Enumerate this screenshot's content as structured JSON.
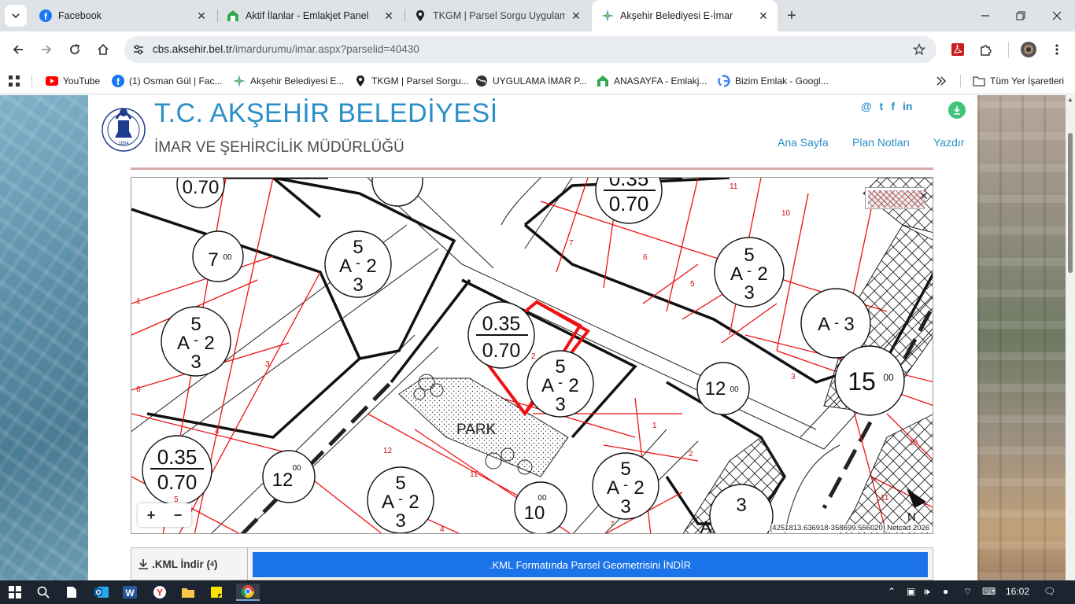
{
  "tabs": [
    {
      "title": "Facebook",
      "icon": "facebook-icon"
    },
    {
      "title": "Aktif İlanlar - Emlakjet Panel",
      "icon": "emlakjet-icon"
    },
    {
      "title": "TKGM | Parsel Sorgu Uygulamas",
      "icon": "map-pin-icon"
    },
    {
      "title": "Akşehir Belediyesi E-İmar",
      "icon": "akşehir-icon",
      "active": true
    }
  ],
  "url": {
    "host": "cbs.aksehir.bel.tr",
    "path": "/imardurumu/imar.aspx?parselid=40430"
  },
  "bookmarks": [
    {
      "label": "YouTube",
      "icon": "youtube-icon"
    },
    {
      "label": "(1) Osman Gül | Fac...",
      "icon": "facebook-icon"
    },
    {
      "label": "Akşehir Belediyesi E...",
      "icon": "akşehir-icon"
    },
    {
      "label": "TKGM | Parsel Sorgu...",
      "icon": "map-pin-icon"
    },
    {
      "label": "UYGULAMA İMAR P...",
      "icon": "globe-icon"
    },
    {
      "label": "ANASAYFA - Emlakj...",
      "icon": "emlakjet-icon"
    },
    {
      "label": "Bizim Emlak - Googl...",
      "icon": "google-icon"
    }
  ],
  "bookmarks_all": "Tüm Yer İşaretleri",
  "header": {
    "title": "T.C. AKŞEHİR BELEDİYESİ",
    "subtitle": "İMAR VE ŞEHİRCİLİK MÜDÜRLÜĞÜ",
    "logo_year": "1854",
    "socials": [
      "@",
      "t",
      "f",
      "in"
    ],
    "nav": [
      "Ana Sayfa",
      "Plan Notları",
      "Yazdır"
    ]
  },
  "map": {
    "coords": "[4251813.636918-358699.556020] Netcad 2026",
    "zoom_in": "+",
    "zoom_out": "−",
    "labels": {
      "park": "PARK",
      "north": "N",
      "ratio_a_top": "0.35",
      "ratio_a_bot": "0.70",
      "ratio_b_top": "0.35",
      "ratio_b_bot": "0.70",
      "ratio_c_top": "0.35",
      "ratio_c_bot": "0.70",
      "ratio_d_bot": "0.70",
      "a_top": "5",
      "a_mid": "A",
      "a_dash": "-",
      "a_right": "2",
      "a_bot": "3",
      "a3_left": "A",
      "a3_dash": "-",
      "a3_right": "3",
      "road_15": "15",
      "road_12": "12",
      "road_10": "10",
      "road_7": "7",
      "road_sup": "00",
      "lot_numbers": [
        "1",
        "2",
        "3",
        "4",
        "5",
        "6",
        "7",
        "10",
        "11",
        "12"
      ]
    }
  },
  "kml": {
    "label": ".KML İndir (4)",
    "label_main": ".KML İndir (",
    "label_sup": "4",
    "label_end": ")",
    "button": ".KML Formatında Parsel Geometrisini İNDİR"
  },
  "taskbar": {
    "time": "16:02"
  }
}
